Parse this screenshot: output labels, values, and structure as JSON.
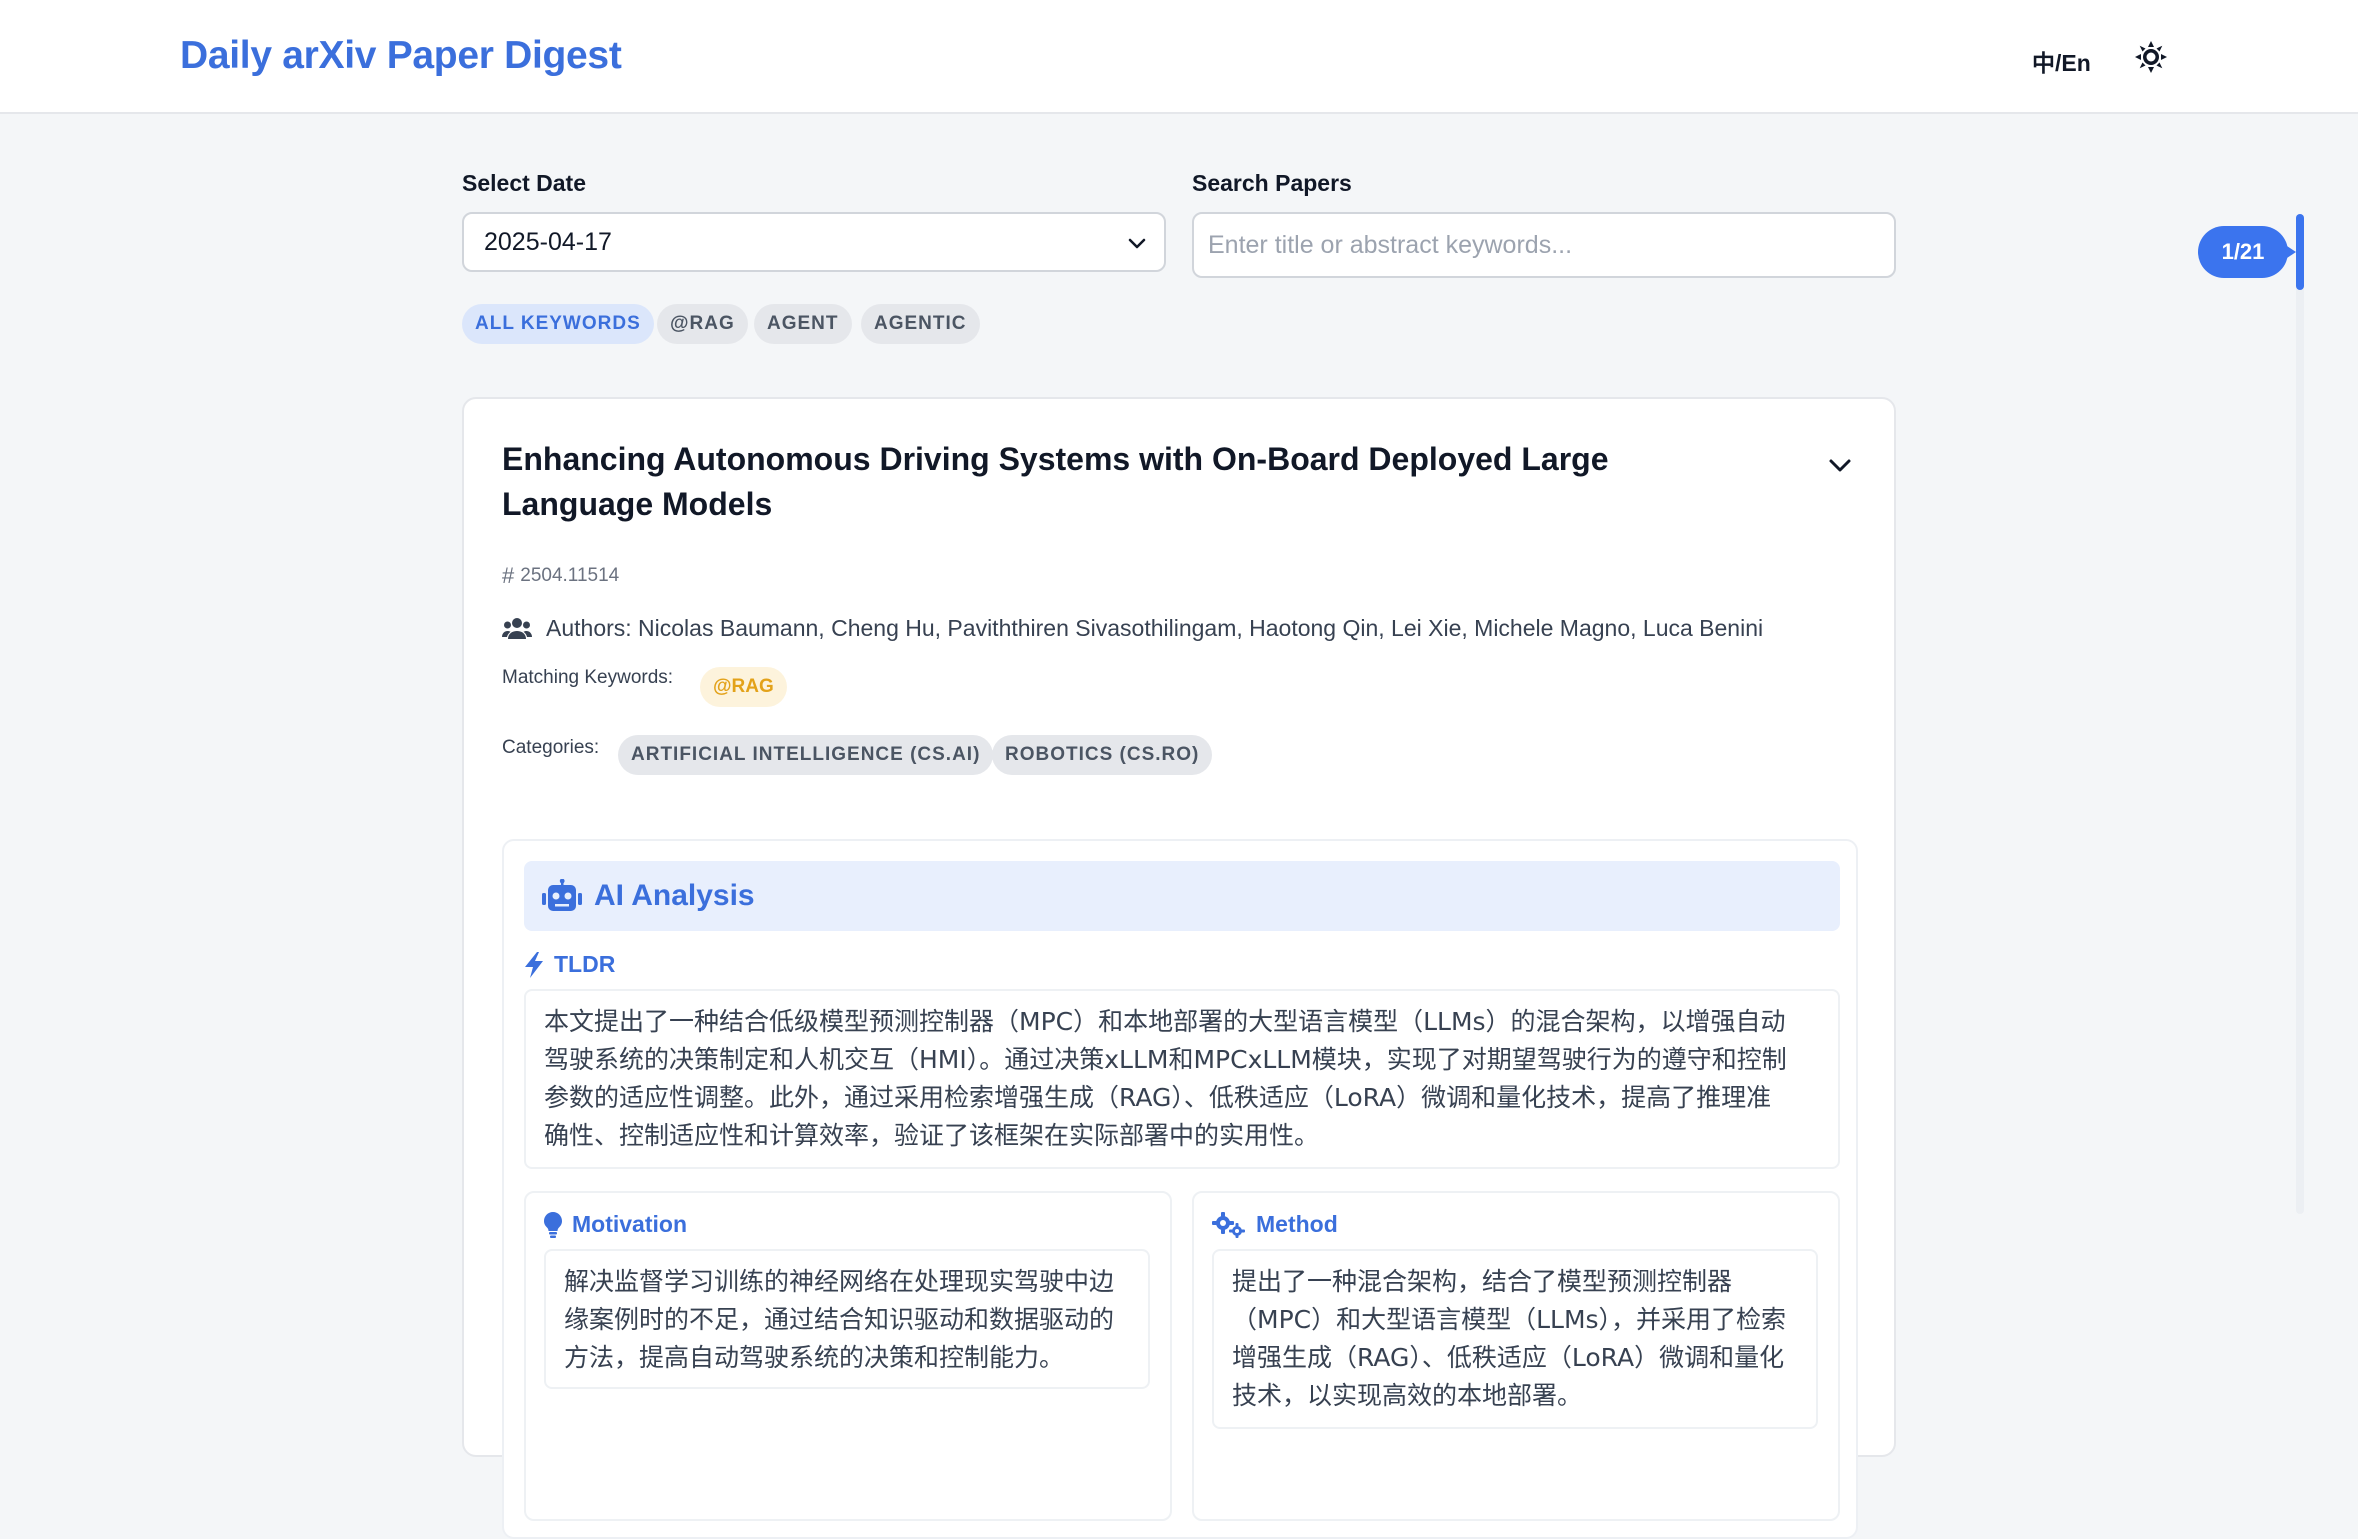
{
  "header": {
    "title": "Daily arXiv Paper Digest",
    "lang_toggle": "中/En",
    "theme_icon": "sun-icon"
  },
  "controls": {
    "date_label": "Select Date",
    "date_value": "2025-04-17",
    "search_label": "Search Papers",
    "search_placeholder": "Enter title or abstract keywords...",
    "search_value": ""
  },
  "keywords": [
    "ALL KEYWORDS",
    "@RAG",
    "AGENT",
    "AGENTIC"
  ],
  "active_keyword": "ALL KEYWORDS",
  "progress": {
    "label": "1/21",
    "current": 1,
    "total": 21
  },
  "paper": {
    "title": "Enhancing Autonomous Driving Systems with On-Board Deployed Large Language Models",
    "id": "2504.11514",
    "authors": "Authors: Nicolas Baumann, Cheng Hu, Paviththiren Sivasothilingam, Haotong Qin, Lei Xie, Michele Magno, Luca Benini",
    "matching_label": "Matching Keywords:",
    "matching_keywords": [
      "@RAG"
    ],
    "categories_label": "Categories:",
    "categories": [
      "ARTIFICIAL INTELLIGENCE (CS.AI)",
      "ROBOTICS (CS.RO)"
    ]
  },
  "analysis": {
    "title": "AI Analysis",
    "tldr_label": "TLDR",
    "tldr_lines": [
      "本文提出了一种结合低级模型预测控制器（MPC）和本地部署的大型语言模型（LLMs）的混合架构，以增强自动",
      "驾驶系统的决策制定和人机交互（HMI）。通过决策xLLM和MPCxLLM模块，实现了对期望驾驶行为的遵守和控制",
      "参数的适应性调整。此外，通过采用检索增强生成（RAG）、低秩适应（LoRA）微调和量化技术，提高了推理准",
      "确性、控制适应性和计算效率，验证了该框架在实际部署中的实用性。"
    ],
    "motivation_label": "Motivation",
    "motivation_lines": [
      "解决监督学习训练的神经网络在处理现实驾驶中边",
      "缘案例时的不足，通过结合知识驱动和数据驱动的",
      "方法，提高自动驾驶系统的决策和控制能力。"
    ],
    "method_label": "Method",
    "method_lines": [
      "提出了一种混合架构，结合了模型预测控制器",
      "（MPC）和大型语言模型（LLMs），并采用了检索",
      "增强生成（RAG）、低秩适应（LoRA）微调和量化",
      "技术，以实现高效的本地部署。"
    ]
  },
  "colors": {
    "accent": "#3b6fdc",
    "progress": "#3b74ee",
    "keyword_highlight": "#e3a21a"
  }
}
